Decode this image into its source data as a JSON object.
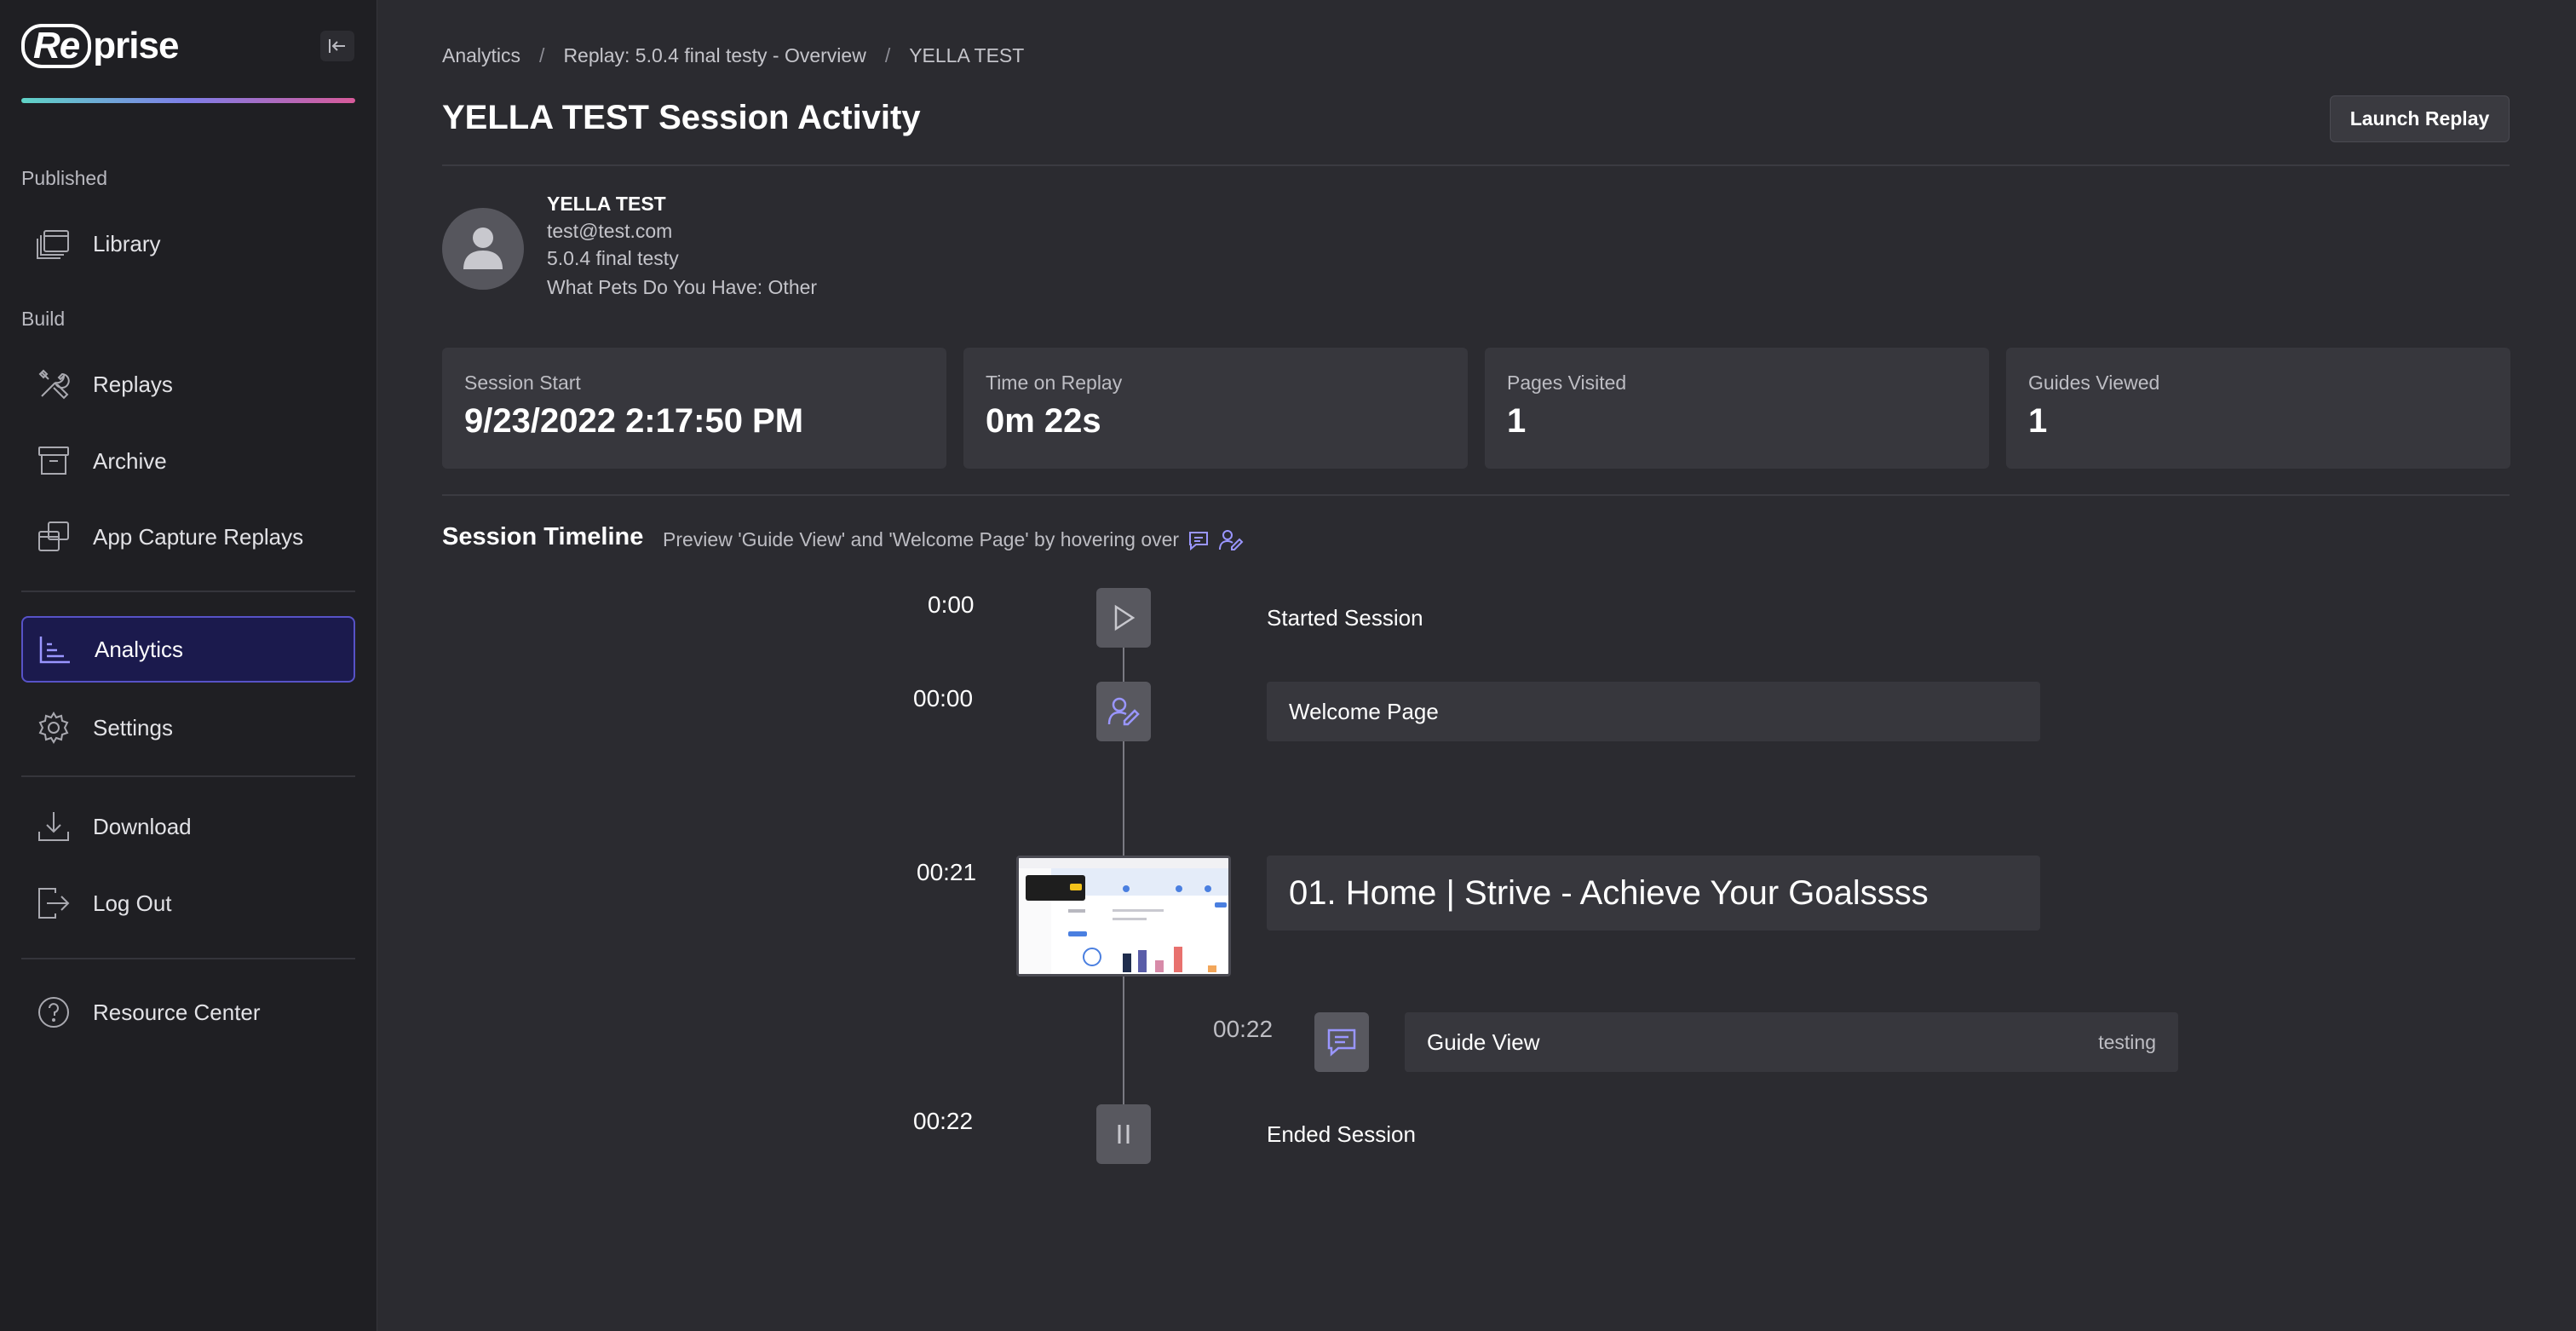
{
  "sidebar": {
    "logo_part1": "Re",
    "logo_part2": "prise",
    "sections": {
      "published": "Published",
      "build": "Build"
    },
    "items": {
      "library": "Library",
      "replays": "Replays",
      "archive": "Archive",
      "app_capture_replays": "App Capture Replays",
      "analytics": "Analytics",
      "settings": "Settings",
      "download": "Download",
      "log_out": "Log Out",
      "resource_center": "Resource Center"
    },
    "active_item": "analytics"
  },
  "breadcrumb": {
    "items": [
      "Analytics",
      "Replay: 5.0.4 final testy - Overview",
      "YELLA TEST"
    ],
    "separator": "/"
  },
  "header": {
    "title": "YELLA TEST Session Activity",
    "launch_label": "Launch Replay"
  },
  "user": {
    "name": "YELLA TEST",
    "email": "test@test.com",
    "replay": "5.0.4 final testy",
    "custom_field": "What Pets Do You Have: Other"
  },
  "stats": [
    {
      "label": "Session Start",
      "value": "9/23/2022 2:17:50 PM"
    },
    {
      "label": "Time on Replay",
      "value": "0m 22s"
    },
    {
      "label": "Pages Visited",
      "value": "1"
    },
    {
      "label": "Guides Viewed",
      "value": "1"
    }
  ],
  "timeline": {
    "title": "Session Timeline",
    "hint": "Preview 'Guide View' and 'Welcome Page' by hovering over",
    "events": [
      {
        "time": "0:00",
        "label": "Started Session",
        "icon": "play-icon"
      },
      {
        "time": "00:00",
        "label": "Welcome Page",
        "icon": "user-edit-icon"
      },
      {
        "time": "00:21",
        "label": "01. Home | Strive - Achieve Your Goalssss",
        "icon": "page-thumbnail"
      },
      {
        "time": "00:22",
        "label": "Guide View",
        "tag": "testing",
        "icon": "message-icon"
      },
      {
        "time": "00:22",
        "label": "Ended Session",
        "icon": "pause-icon"
      }
    ]
  },
  "colors": {
    "sidebar_bg": "#1f1f23",
    "main_bg": "#2b2b30",
    "card_bg": "#37373d",
    "accent": "#5752c7",
    "icon_accent": "#9a96ff"
  }
}
